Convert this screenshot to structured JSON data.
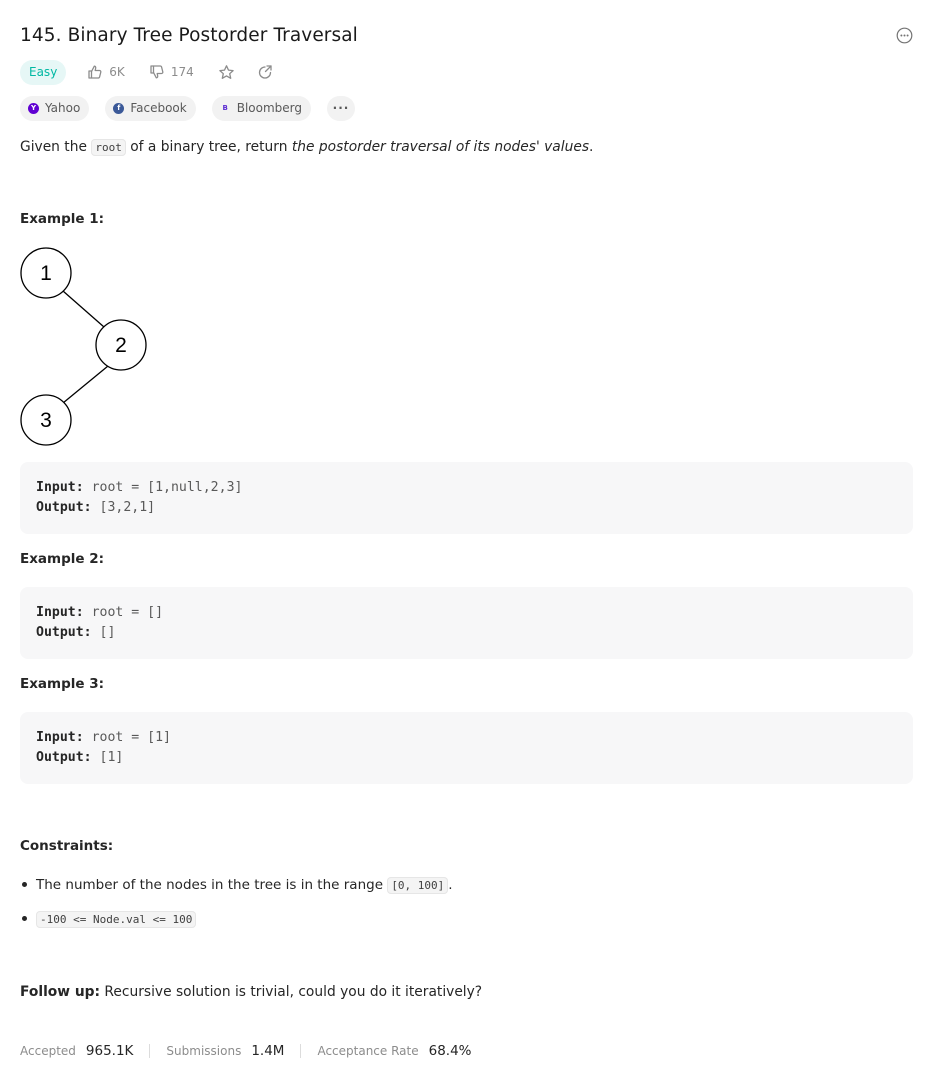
{
  "problem": {
    "title": "145. Binary Tree Postorder Traversal",
    "difficulty": "Easy",
    "likes": "6K",
    "dislikes": "174"
  },
  "tags": [
    {
      "label": "Yahoo",
      "color": "#6001d2",
      "letter": "Y"
    },
    {
      "label": "Facebook",
      "color": "#3b5998",
      "letter": "f"
    },
    {
      "label": "Bloomberg",
      "color": "#ffffff",
      "letter": "B"
    }
  ],
  "tag_more": "···",
  "description": {
    "prefix": "Given the ",
    "code": "root",
    "middle": " of a binary tree, return ",
    "italic": "the postorder traversal of its nodes' values",
    "suffix": "."
  },
  "examples": [
    {
      "heading": "Example 1:",
      "input_label": "Input:",
      "input": "root = [1,null,2,3]",
      "output_label": "Output:",
      "output": "[3,2,1]"
    },
    {
      "heading": "Example 2:",
      "input_label": "Input:",
      "input": "root = []",
      "output_label": "Output:",
      "output": "[]"
    },
    {
      "heading": "Example 3:",
      "input_label": "Input:",
      "input": "root = [1]",
      "output_label": "Output:",
      "output": "[1]"
    }
  ],
  "tree_nodes": [
    "1",
    "2",
    "3"
  ],
  "constraints": {
    "heading": "Constraints:",
    "item1_prefix": "The number of the nodes in the tree is in the range ",
    "item1_code": "[0, 100]",
    "item1_suffix": ".",
    "item2_code": "-100 <= Node.val <= 100"
  },
  "followup": {
    "label": "Follow up:",
    "text": " Recursive solution is trivial, could you do it iteratively?"
  },
  "stats": {
    "accepted_label": "Accepted",
    "accepted_value": "965.1K",
    "submissions_label": "Submissions",
    "submissions_value": "1.4M",
    "rate_label": "Acceptance Rate",
    "rate_value": "68.4%"
  },
  "colors": {
    "easy": "#00b8a3",
    "easy_bg": "#e6f7f6",
    "muted": "#8c8c8c"
  }
}
